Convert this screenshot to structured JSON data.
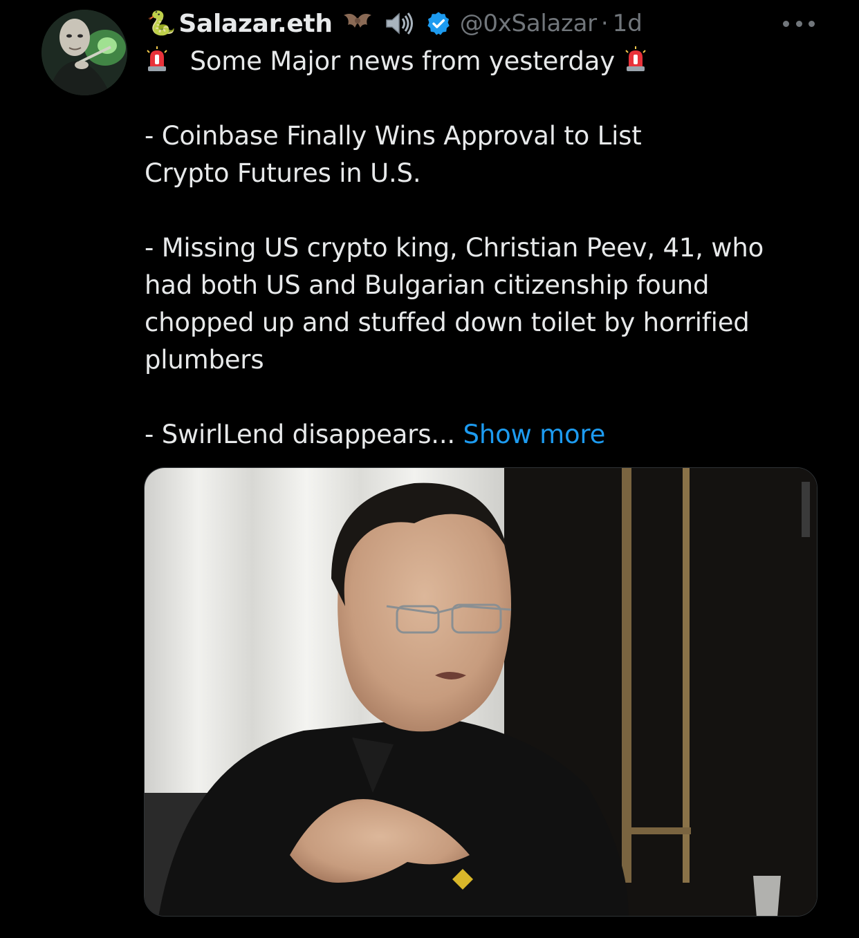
{
  "tweet": {
    "author": {
      "display_name": "Salazar.eth",
      "handle": "@0xSalazar",
      "separator": "·",
      "time": "1d",
      "name_emojis": [
        "snake-emoji",
        "bat-emoji",
        "speaker-emoji"
      ],
      "verified": true,
      "verified_color": "#1d9bf0"
    },
    "text": {
      "line1": "Some Major news from yesterday",
      "item1_line1": "- Coinbase Finally Wins Approval to List",
      "item1_line2": "Crypto Futures in U.S.",
      "item2_line1": "- Missing US crypto king, Christian Peev, 41, who",
      "item2_line2": "had both US and Bulgarian citizenship found",
      "item2_line3": "chopped up and stuffed down toilet by horrified",
      "item2_line4": "plumbers",
      "item3_line1": "- SwirlLend disappears...",
      "show_more": "Show more"
    },
    "media": {
      "alt": "photo of man in black polo shirt speaking"
    }
  },
  "colors": {
    "background": "#000000",
    "text": "#e7e9ea",
    "muted": "#71767b",
    "link": "#1d9bf0"
  }
}
